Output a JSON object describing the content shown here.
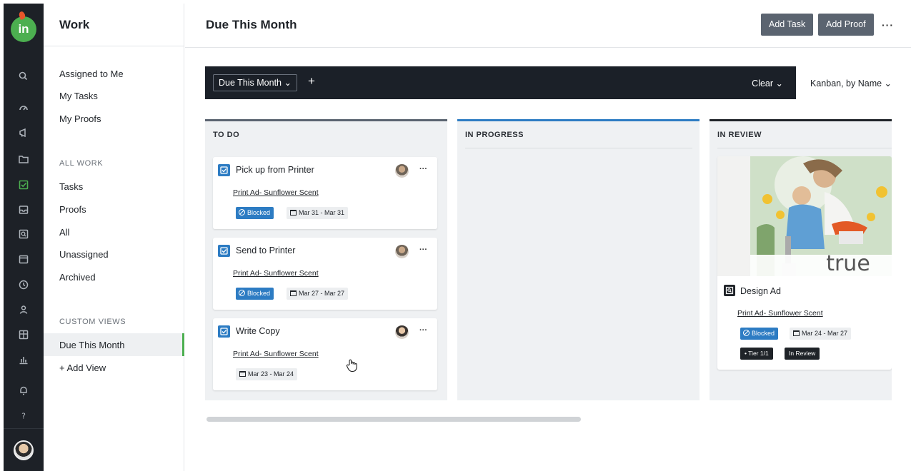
{
  "rail": {
    "logo": "in",
    "icons": [
      "search-icon",
      "dashboard-icon",
      "campaign-icon",
      "folder-icon",
      "tasks-icon",
      "inbox-icon",
      "proof-icon",
      "calendar-icon",
      "time-icon",
      "people-icon",
      "layout-icon",
      "reports-icon",
      "notifications-icon",
      "help-icon"
    ],
    "active_icon": "tasks-icon",
    "active_color": "#4caf50"
  },
  "sidebar": {
    "title": "Work",
    "quick": [
      "Assigned to Me",
      "My Tasks",
      "My Proofs"
    ],
    "all_work_label": "ALL WORK",
    "all_work": [
      "Tasks",
      "Proofs",
      "All",
      "Unassigned",
      "Archived"
    ],
    "custom_views_label": "CUSTOM VIEWS",
    "active_view": "Due This Month",
    "add_view": "+ Add View"
  },
  "header": {
    "title": "Due This Month",
    "add_task": "Add Task",
    "add_proof": "Add Proof",
    "more": "···"
  },
  "filters": {
    "active_filter": "Due This Month ⌄",
    "add": "+",
    "clear": "Clear ⌄",
    "view_mode": "Kanban, by Name ⌄"
  },
  "columns": [
    {
      "title": "TO DO",
      "accent": "#5b6470",
      "cards": [
        {
          "title": "Pick up from Printer",
          "project": "Print Ad- Sunflower Scent",
          "status": "Blocked",
          "dates": "Mar 31 - Mar 31"
        },
        {
          "title": "Send to Printer",
          "project": "Print Ad- Sunflower Scent",
          "status": "Blocked",
          "dates": "Mar 27 - Mar 27"
        },
        {
          "title": "Write Copy",
          "project": "Print Ad- Sunflower Scent",
          "status": "",
          "dates": "Mar 23 - Mar 24"
        }
      ]
    },
    {
      "title": "IN PROGRESS",
      "accent": "#2d7cc3",
      "cards": []
    },
    {
      "title": "IN REVIEW",
      "accent": "#1f2328",
      "cards": [
        {
          "title": "Design Ad",
          "project": "Print Ad- Sunflower Scent",
          "status": "Blocked",
          "dates": "Mar 24 - Mar 27",
          "tier": "• Tier 1/1",
          "review_status": "In Review",
          "image_text": "true"
        }
      ]
    }
  ],
  "card_more": "···"
}
